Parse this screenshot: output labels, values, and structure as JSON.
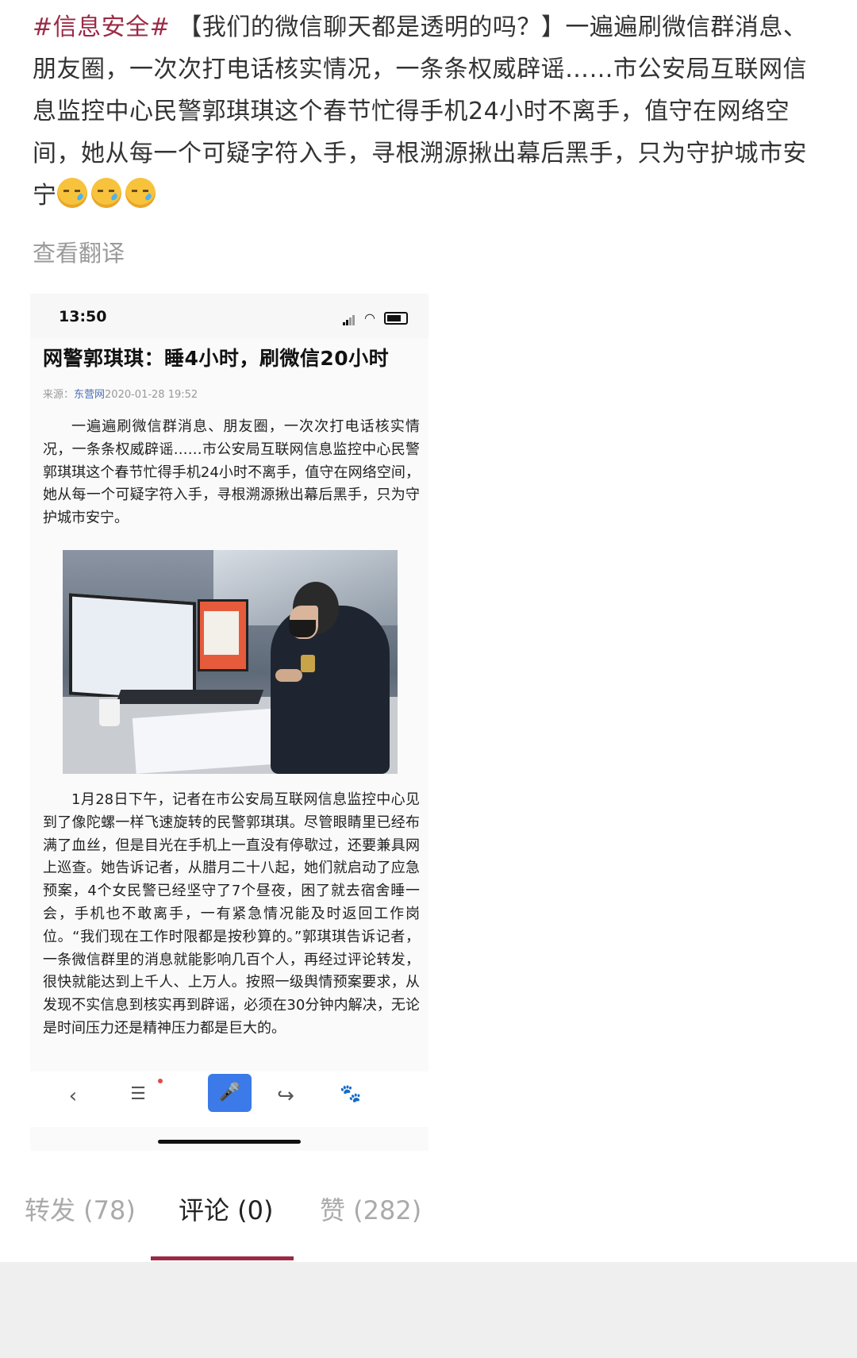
{
  "post": {
    "hashtag": "#信息安全#",
    "text": " 【我们的微信聊天都是透明的吗？】一遍遍刷微信群消息、朋友圈，一次次打电话核实情况，一条条权威辟谣……市公安局互联网信息监控中心民警郭琪琪这个春节忙得手机24小时不离手，值守在网络空间，她从每一个可疑字符入手，寻根溯源揪出幕后黑手，只为守护城市安宁",
    "emoji_icon": "sweat-face-icon",
    "translate_label": "查看翻译"
  },
  "screenshot": {
    "status_time": "13:50",
    "article_title": "网警郭琪琪：睡4小时，刷微信20小时",
    "source_label": "来源：",
    "source_name": "东营网",
    "source_datetime": "2020-01-28 19:52",
    "para1": "一遍遍刷微信群消息、朋友圈，一次次打电话核实情况，一条条权威辟谣……市公安局互联网信息监控中心民警郭琪琪这个春节忙得手机24小时不离手，值守在网络空间，她从每一个可疑字符入手，寻根溯源揪出幕后黑手，只为守护城市安宁。",
    "para2": "1月28日下午，记者在市公安局互联网信息监控中心见到了像陀螺一样飞速旋转的民警郭琪琪。尽管眼睛里已经布满了血丝，但是目光在手机上一直没有停歇过，还要兼具网上巡查。她告诉记者，从腊月二十八起，她们就启动了应急预案，4个女民警已经坚守了7个昼夜，困了就去宿舍睡一会，手机也不敢离手，一有紧急情况能及时返回工作岗位。“我们现在工作时限都是按秒算的。”郭琪琪告诉记者，一条微信群里的消息就能影响几百个人，再经过评论转发，很快就能达到上千人、上万人。按照一级舆情预案要求，从发现不实信息到核实再到辟谣，必须在30分钟内解决，无论是时间压力还是精神压力都是巨大的。",
    "nav": {
      "back_icon": "‹",
      "menu_icon": "☰",
      "mic_icon": "🎤",
      "share_icon": "↪",
      "paw_icon": "🐾"
    }
  },
  "tabs": [
    {
      "label": "转发 (78)"
    },
    {
      "label": "评论 (0)"
    },
    {
      "label": "赞 (282)"
    }
  ],
  "colors": {
    "accent": "#9b2a45",
    "muted": "#aaaaaa"
  }
}
